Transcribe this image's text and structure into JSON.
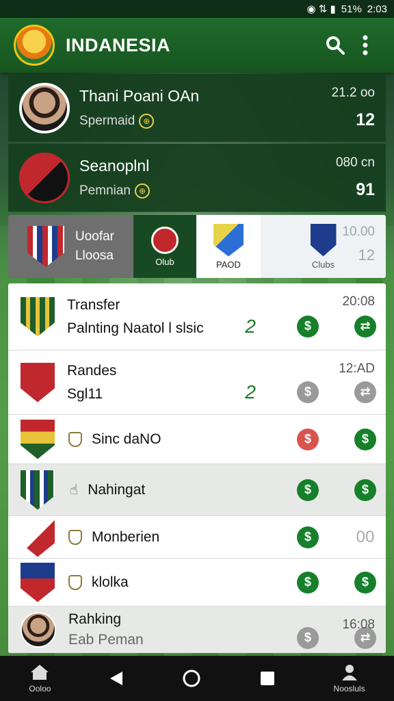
{
  "status": {
    "icons": "◉ ⇅ ▮",
    "battery": "51%",
    "time": "2:03"
  },
  "appbar": {
    "title": "INDANESIA",
    "search_icon": "search-icon",
    "menu_icon": "more-vertical-icon"
  },
  "players": [
    {
      "name": "Thani Poani OAn",
      "sub": "Spermaid",
      "stat": "21.2 oo",
      "num": "12"
    },
    {
      "name": "Seanoplnl",
      "sub": "Pemnian",
      "stat": "080 cn",
      "num": "91"
    }
  ],
  "clubstrip": {
    "label1": "Uoofar",
    "label2": "Lloosa",
    "cell2": "Olub",
    "cell3": "PAOD",
    "cell4": "Clubs",
    "time": "10.00",
    "count": "12"
  },
  "list": [
    {
      "title": "Transfer",
      "sub": "Palnting Naatol l slsic",
      "time": "20:08",
      "count": "2"
    },
    {
      "title": "Randes",
      "sub": "Sgl11",
      "time": "12:AD",
      "count": "2"
    },
    {
      "title": "Sinc daNO"
    },
    {
      "title": "Nahingat"
    },
    {
      "title": "Monberien",
      "value": "00"
    },
    {
      "title": "klolka"
    },
    {
      "title": "Rahking",
      "sub": "Eab Peman",
      "time": "16:08"
    }
  ],
  "nav": {
    "home": "Ooloo",
    "profile": "Noosluls"
  }
}
